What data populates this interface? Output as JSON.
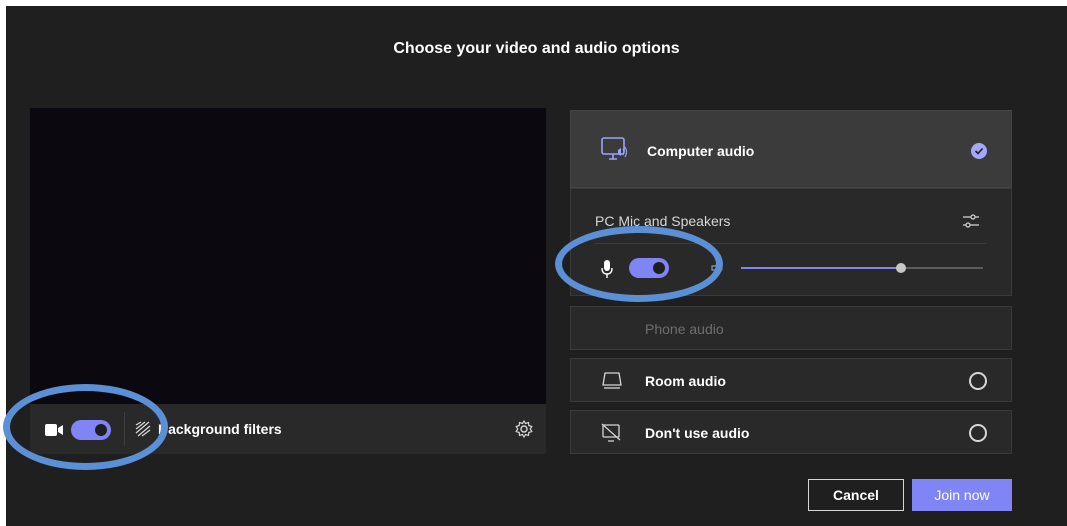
{
  "dialog": {
    "title": "Choose your video and audio options"
  },
  "video": {
    "camera_toggle_on": true,
    "background_filters_label": "Background filters"
  },
  "audio": {
    "computer_audio_label": "Computer audio",
    "computer_audio_selected": true,
    "device_label": "PC Mic and Speakers",
    "mic_toggle_on": true,
    "volume_level": 0.66,
    "phone_audio_label": "Phone audio",
    "room_audio_label": "Room audio",
    "no_audio_label": "Don't use audio"
  },
  "actions": {
    "cancel_label": "Cancel",
    "join_label": "Join now"
  },
  "colors": {
    "accent": "#7f85f5",
    "background": "#1f1f1f",
    "annotation": "#5b8fd6"
  },
  "icons": [
    "camera-icon",
    "background-filters-icon",
    "gear-icon",
    "computer-audio-icon",
    "check-icon",
    "settings-sliders-icon",
    "mic-icon",
    "speaker-icon",
    "room-audio-icon",
    "no-audio-icon"
  ]
}
